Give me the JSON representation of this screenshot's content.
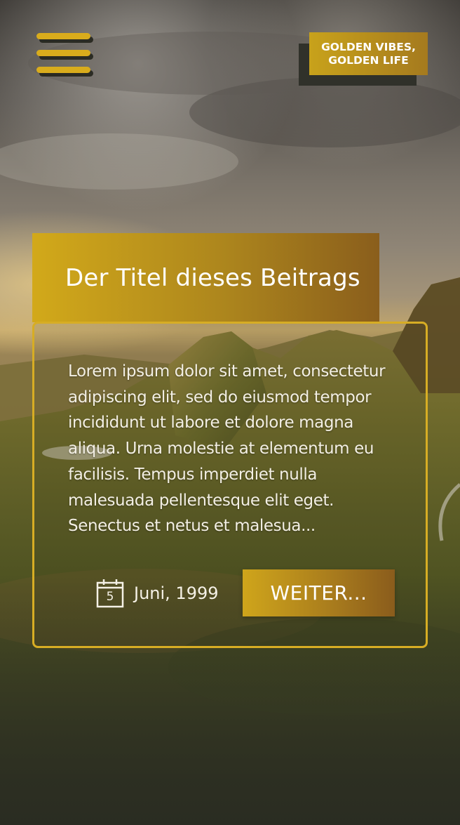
{
  "header": {
    "menu_icon": "hamburger-menu-icon",
    "brand_line1": "GOLDEN VIBES,",
    "brand_line2": "GOLDEN LIFE"
  },
  "post": {
    "title": "Der Titel dieses Beitrags",
    "excerpt": "Lorem ipsum dolor sit amet, consectetur adipiscing elit, sed do eiusmod tempor incididunt ut labore et dolore magna aliqua. Urna molestie at elementum eu facilisis. Tempus imperdiet nulla malesuada pellentesque elit eget. Senectus et netus et malesua...",
    "date_icon": "calendar-icon",
    "date_day": "5",
    "date_text": "Juni, 1999",
    "more_label": "WEITER..."
  },
  "colors": {
    "accent_gold": "#d9ac1c",
    "accent_gold_dark": "#8a5e1c",
    "text_light": "#f3efe4",
    "shadow": "#30312a"
  }
}
